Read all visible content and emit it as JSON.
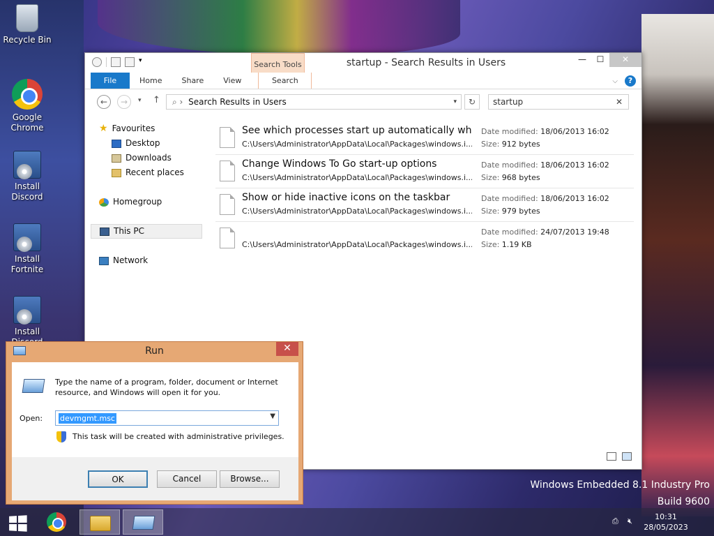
{
  "desktop": {
    "icons": [
      {
        "label": "Recycle Bin",
        "icon": "recycle-bin-icon"
      },
      {
        "label": "Google Chrome",
        "icon": "chrome-icon"
      },
      {
        "label": "Install Discord",
        "icon": "installer-icon"
      },
      {
        "label": "Install Fortnite",
        "icon": "installer-icon"
      },
      {
        "label": "Install Discord",
        "icon": "installer-icon"
      }
    ],
    "watermark_line1": "Windows Embedded 8.1 Industry Pro",
    "watermark_line2": "Build 9600"
  },
  "explorer": {
    "title": "startup - Search Results in Users",
    "context_tab": "Search Tools",
    "tabs": [
      "File",
      "Home",
      "Share",
      "View",
      "Search"
    ],
    "address": "Search Results in Users",
    "search_value": "startup",
    "nav": {
      "favourites": "Favourites",
      "desktop": "Desktop",
      "downloads": "Downloads",
      "recent": "Recent places",
      "homegroup": "Homegroup",
      "thispc": "This PC",
      "network": "Network"
    },
    "date_label": "Date modified:",
    "size_label": "Size:",
    "results": [
      {
        "title": "See which processes start up automatically whe...",
        "path": "C:\\Users\\Administrator\\AppData\\Local\\Packages\\windows.i...",
        "date": "18/06/2013 16:02",
        "size": "912 bytes"
      },
      {
        "title": "Change Windows To Go start-up options",
        "path": "C:\\Users\\Administrator\\AppData\\Local\\Packages\\windows.i...",
        "date": "18/06/2013 16:02",
        "size": "968 bytes"
      },
      {
        "title": "Show or hide inactive icons on the taskbar",
        "path": "C:\\Users\\Administrator\\AppData\\Local\\Packages\\windows.i...",
        "date": "18/06/2013 16:02",
        "size": "979 bytes"
      },
      {
        "title": "",
        "path": "C:\\Users\\Administrator\\AppData\\Local\\Packages\\windows.i...",
        "date": "24/07/2013 19:48",
        "size": "1.19 KB"
      }
    ]
  },
  "run": {
    "title": "Run",
    "description": "Type the name of a program, folder, document or Internet resource, and Windows will open it for you.",
    "open_label": "Open:",
    "open_value": "devmgmt.msc",
    "privilege_note": "This task will be created with administrative privileges.",
    "ok": "OK",
    "cancel": "Cancel",
    "browse": "Browse..."
  },
  "taskbar": {
    "time": "10:31",
    "date": "28/05/2023"
  },
  "colors": {
    "accent": "#1979ca",
    "run_frame": "#e6a874",
    "selection": "#3399ff"
  }
}
